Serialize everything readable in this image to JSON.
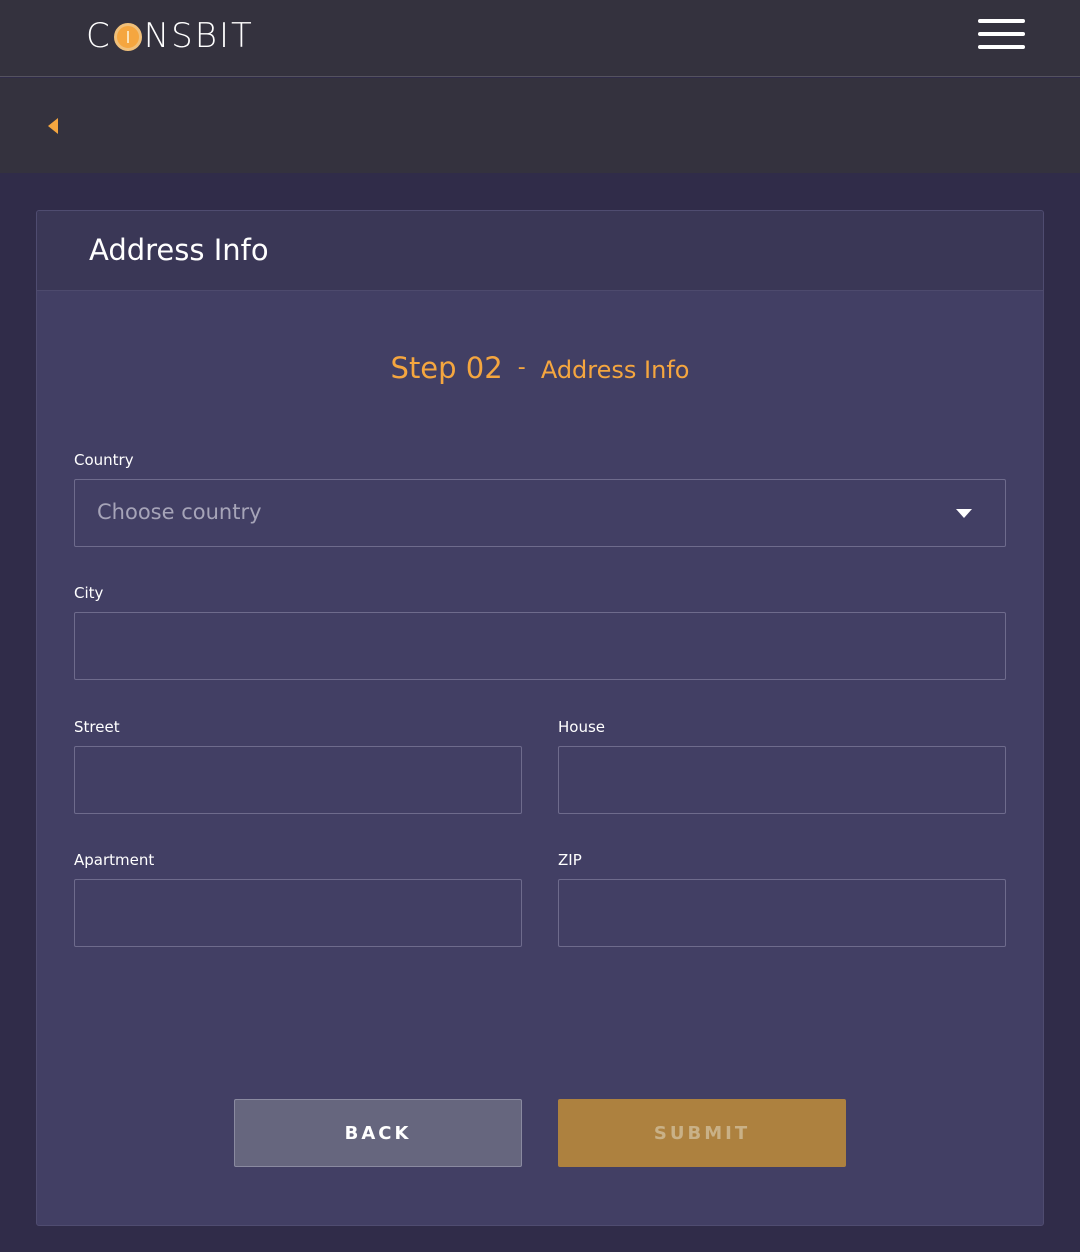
{
  "header": {
    "logo_prefix": "C",
    "logo_suffix": "NSBIT",
    "menu_icon": "hamburger-menu-icon",
    "back_icon": "caret-left-icon"
  },
  "card": {
    "title": "Address Info"
  },
  "step": {
    "number": "Step 02",
    "separator": "-",
    "name": "Address Info"
  },
  "form": {
    "country": {
      "label": "Country",
      "placeholder": "Choose country",
      "icon": "chevron-down-icon"
    },
    "city": {
      "label": "City",
      "value": ""
    },
    "street": {
      "label": "Street",
      "value": ""
    },
    "house": {
      "label": "House",
      "value": ""
    },
    "apartment": {
      "label": "Apartment",
      "value": ""
    },
    "zip": {
      "label": "ZIP",
      "value": ""
    }
  },
  "actions": {
    "back_label": "BACK",
    "submit_label": "SUBMIT"
  },
  "colors": {
    "accent": "#f5a63f",
    "background": "#302c49",
    "card": "#423f64",
    "topbar": "#34323e",
    "submit": "#ad813f",
    "back": "#66667e"
  }
}
